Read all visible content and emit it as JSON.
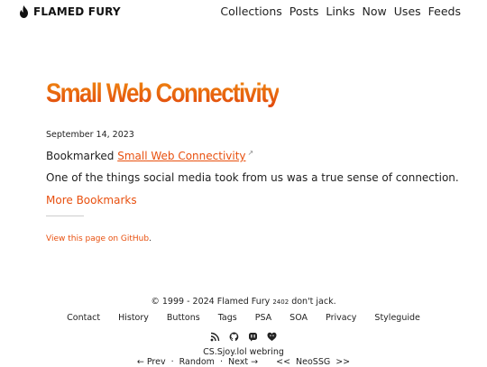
{
  "site": {
    "name": "FLAMED FURY",
    "logo_icon": "flame-icon"
  },
  "nav": [
    "Collections",
    "Posts",
    "Links",
    "Now",
    "Uses",
    "Feeds"
  ],
  "post": {
    "title": "Small Web Connectivity",
    "date": "September 14, 2023",
    "bookmarked_prefix": "Bookmarked",
    "bookmarked_link": "Small Web Connectivity",
    "external_icon": "↗",
    "description": "One of the things social media took from us was a true sense of connection.",
    "more_link": "More Bookmarks",
    "github_link": "View this page on GitHub",
    "github_suffix": "."
  },
  "footer": {
    "copyright": "© 1999 - 2024",
    "author_link": "Flamed Fury",
    "author_sub": "2402",
    "tagline": "don't jack.",
    "links": [
      "Contact",
      "History",
      "Buttons",
      "Tags",
      "PSA",
      "SOA",
      "Privacy",
      "Styleguide"
    ],
    "icons": [
      "rss-icon",
      "github-icon",
      "mastodon-icon",
      "heart-icon"
    ],
    "webring_link": "CS.Sjoy.lol",
    "webring_label": "webring",
    "ring_prev": "← Prev",
    "ring_random": "Random",
    "ring_next": "Next →",
    "ring_sep": "·",
    "neo_prev": "<<",
    "neo_label": "NeoSSG",
    "neo_next": ">>"
  },
  "colors": {
    "accent": "#e8500f",
    "text": "#222222"
  }
}
